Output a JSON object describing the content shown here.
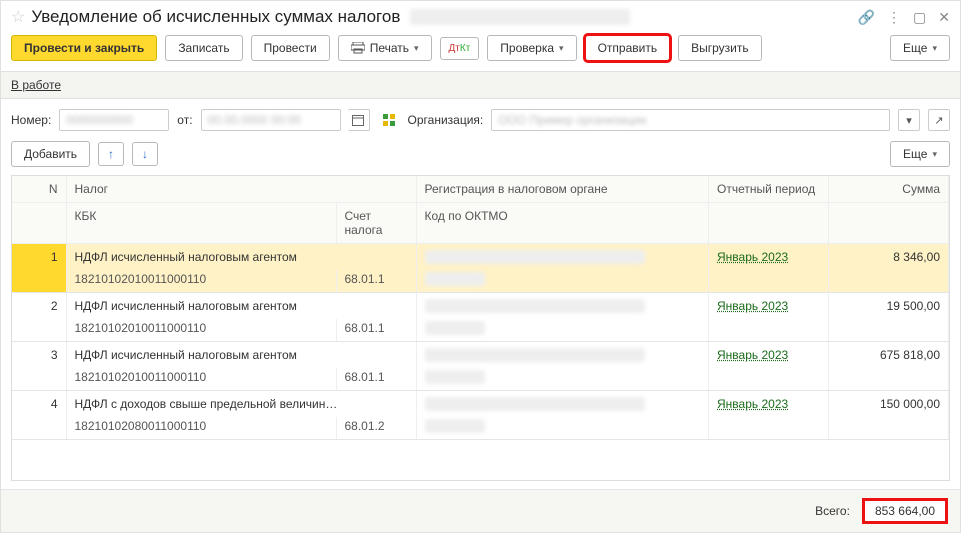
{
  "title": "Уведомление об исчисленных суммах налогов",
  "toolbar": {
    "post_close": "Провести и закрыть",
    "save": "Записать",
    "post": "Провести",
    "print": "Печать",
    "check": "Проверка",
    "send": "Отправить",
    "export": "Выгрузить",
    "more": "Еще"
  },
  "status": {
    "label": "В работе"
  },
  "fields": {
    "number_label": "Номер:",
    "from_label": "от:",
    "org_label": "Организация:"
  },
  "table_toolbar": {
    "add": "Добавить",
    "more": "Еще"
  },
  "grid": {
    "headers": {
      "n": "N",
      "tax": "Налог",
      "reg": "Регистрация в налоговом органе",
      "period": "Отчетный период",
      "sum": "Сумма",
      "kbk": "КБК",
      "acct": "Счет налога",
      "oktmo": "Код по ОКТМО"
    },
    "rows": [
      {
        "n": 1,
        "tax": "НДФЛ исчисленный налоговым агентом",
        "kbk": "18210102010011000110",
        "acct": "68.01.1",
        "period": "Январь 2023",
        "sum": "8 346,00"
      },
      {
        "n": 2,
        "tax": "НДФЛ исчисленный налоговым агентом",
        "kbk": "18210102010011000110",
        "acct": "68.01.1",
        "period": "Январь 2023",
        "sum": "19 500,00"
      },
      {
        "n": 3,
        "tax": "НДФЛ исчисленный налоговым агентом",
        "kbk": "18210102010011000110",
        "acct": "68.01.1",
        "period": "Январь 2023",
        "sum": "675 818,00"
      },
      {
        "n": 4,
        "tax": "НДФЛ с доходов свыше предельной величин…",
        "kbk": "18210102080011000110",
        "acct": "68.01.2",
        "period": "Январь 2023",
        "sum": "150 000,00"
      }
    ]
  },
  "footer": {
    "total_label": "Всего:",
    "total_value": "853 664,00"
  }
}
